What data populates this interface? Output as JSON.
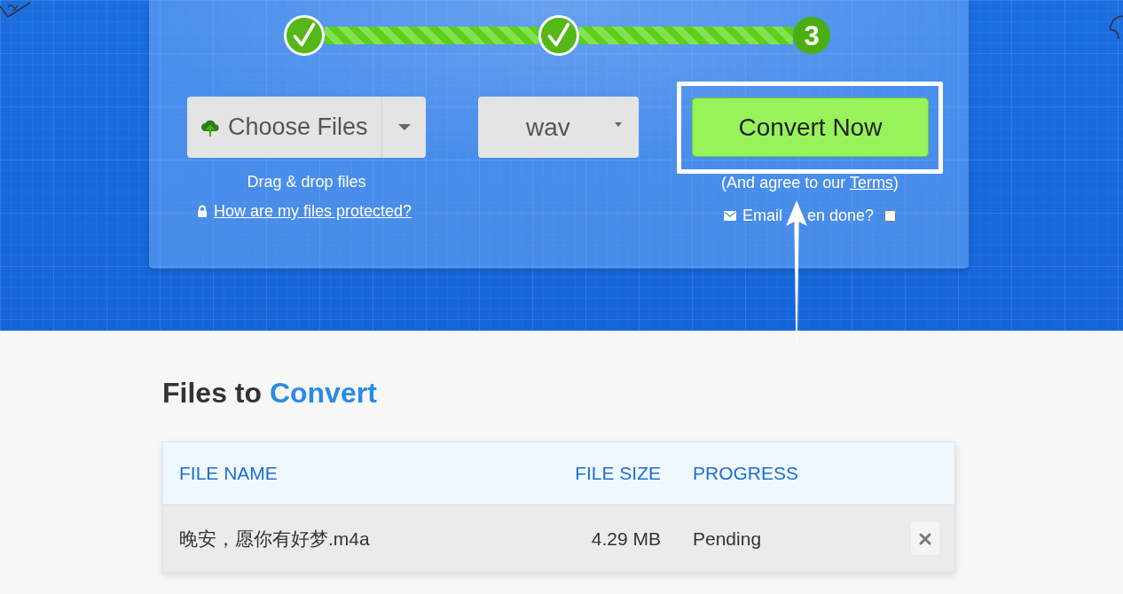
{
  "steps": [
    {
      "completed": true
    },
    {
      "completed": true
    },
    {
      "completed": false,
      "label": "3"
    }
  ],
  "upload": {
    "button": "Choose Files",
    "hint": "Drag & drop files",
    "protection_link": "How are my files protected?"
  },
  "format": {
    "value": "wav"
  },
  "convert": {
    "button": "Convert Now",
    "terms_before": "(And agree to our",
    "terms_link": "Terms",
    "terms_after": ")",
    "email_label_before_arrow": "Email",
    "email_label_after_arrow": "en done?",
    "email_checked": false
  },
  "annotation": {
    "frame_around_convert": true,
    "arrow": true
  },
  "files": {
    "title": "Files to",
    "title_highlight": "Convert",
    "columns": [
      "FILE NAME",
      "FILE SIZE",
      "PROGRESS"
    ],
    "rows": [
      {
        "name": "晚安，愿你有好梦.m4a",
        "size": "4.29 MB",
        "progress": "Pending"
      }
    ]
  }
}
